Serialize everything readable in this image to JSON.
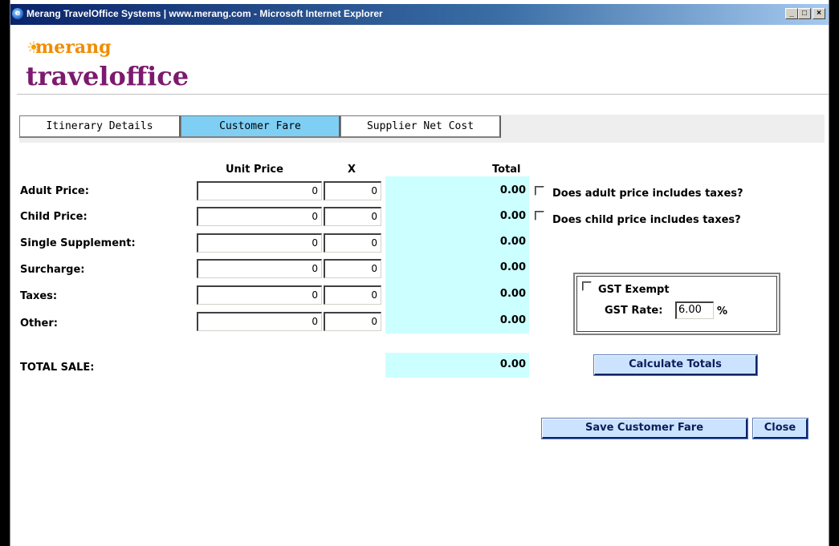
{
  "window": {
    "title": "Merang TravelOffice Systems | www.merang.com - Microsoft Internet Explorer",
    "minimize": "_",
    "maximize": "□",
    "close": "×"
  },
  "logo": {
    "brand_top": "merang",
    "brand_main_1": "travel",
    "brand_main_2": "office"
  },
  "tabs": [
    {
      "label": "Itinerary Details",
      "active": false
    },
    {
      "label": "Customer Fare",
      "active": true
    },
    {
      "label": "Supplier Net Cost",
      "active": false
    }
  ],
  "table": {
    "headers": {
      "unit_price": "Unit Price",
      "qty": "X",
      "total": "Total"
    },
    "rows": [
      {
        "label": "Adult Price:",
        "unit_price": "0",
        "qty": "0",
        "total": "0.00"
      },
      {
        "label": "Child Price:",
        "unit_price": "0",
        "qty": "0",
        "total": "0.00"
      },
      {
        "label": "Single Supplement:",
        "unit_price": "0",
        "qty": "0",
        "total": "0.00"
      },
      {
        "label": "Surcharge:",
        "unit_price": "0",
        "qty": "0",
        "total": "0.00"
      },
      {
        "label": "Taxes:",
        "unit_price": "0",
        "qty": "0",
        "total": "0.00"
      },
      {
        "label": "Other:",
        "unit_price": "0",
        "qty": "0",
        "total": "0.00"
      }
    ],
    "total_sale_label": "TOTAL SALE:",
    "total_sale_value": "0.00"
  },
  "tax_options": {
    "adult_includes_taxes": "Does adult price includes taxes?",
    "child_includes_taxes": "Does child price includes taxes?"
  },
  "gst": {
    "exempt_label": "GST Exempt",
    "rate_label": "GST Rate:",
    "rate_value": "6.00",
    "rate_unit": "%"
  },
  "buttons": {
    "calculate": "Calculate Totals",
    "save": "Save Customer Fare",
    "close": "Close"
  },
  "colors": {
    "active_tab": "#7fcff5",
    "total_column": "#ccffff",
    "button_bg": "#cce3ff",
    "logo_orange": "#f08c00",
    "logo_purple": "#7b1a6e"
  }
}
